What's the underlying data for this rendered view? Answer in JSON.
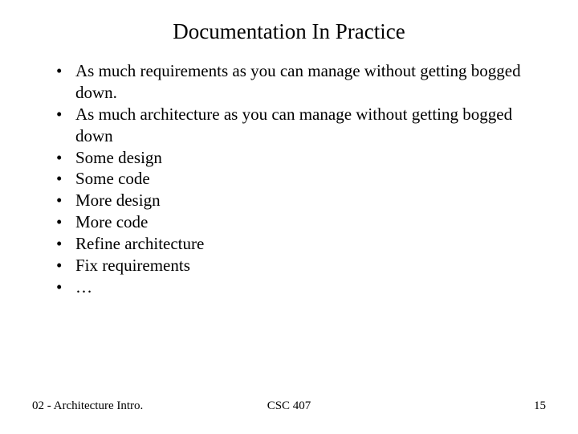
{
  "title": "Documentation In Practice",
  "bullets": [
    "As much requirements as you can manage without getting bogged down.",
    "As much architecture as you can manage without getting bogged down",
    "Some design",
    "Some code",
    "More design",
    "More code",
    "Refine architecture",
    "Fix requirements",
    "…"
  ],
  "footer": {
    "left": "02 - Architecture Intro.",
    "center": "CSC 407",
    "right": "15"
  }
}
